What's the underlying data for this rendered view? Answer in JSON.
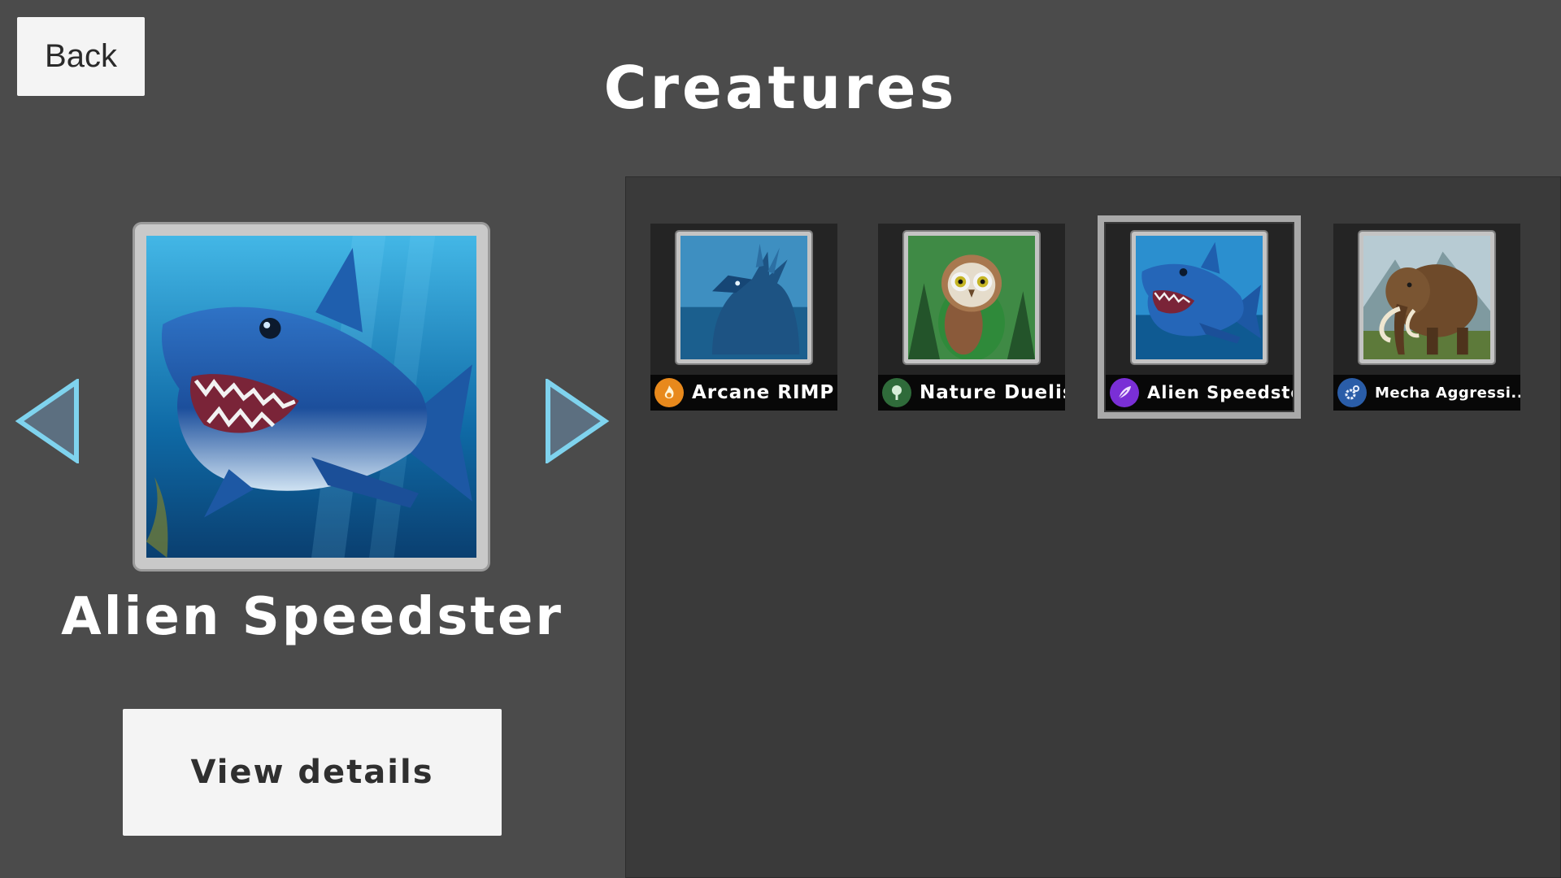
{
  "header": {
    "back_label": "Back",
    "title": "Creatures"
  },
  "selected": {
    "name": "Alien Speedster",
    "portrait": "shark",
    "view_details_label": "View details"
  },
  "navigation": {
    "prev_icon": "triangle-left-arrow",
    "next_icon": "triangle-right-arrow",
    "arrow_color": "#7fd3ee"
  },
  "creatures": [
    {
      "name": "Arcane RIMP",
      "art": "sea-dragon",
      "faction_icon": "arcane-flame-icon",
      "faction_color": "#e8891c",
      "selected": false
    },
    {
      "name": "Nature Duelist",
      "art": "owl",
      "faction_icon": "tree-icon",
      "faction_color": "#2f6b3a",
      "selected": false
    },
    {
      "name": "Alien Speedster",
      "art": "shark",
      "faction_icon": "alien-feather-icon",
      "faction_color": "#7a2fd6",
      "selected": true
    },
    {
      "name": "Mecha Aggressi...",
      "art": "mammoth",
      "faction_icon": "gear-icon",
      "faction_color": "#2a5da8",
      "selected": false
    }
  ]
}
